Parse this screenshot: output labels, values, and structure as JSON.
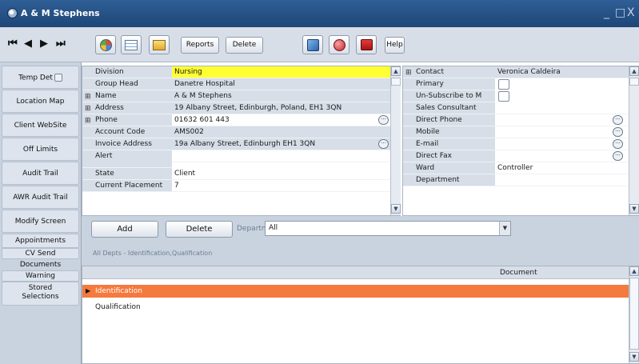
{
  "window": {
    "title": "A & M Stephens",
    "controls": [
      "_",
      "□",
      "X"
    ]
  },
  "toolbar": {
    "nav": [
      "⏮",
      "◀",
      "▶",
      "⏭"
    ],
    "icons": [
      "refresh-icon",
      "grid-view-icon",
      "note-icon",
      "phone-icon",
      "globe-icon",
      "delete-record-icon"
    ],
    "reports_label": "Reports",
    "delete_label": "Delete",
    "help_label": "Help"
  },
  "left_nav": {
    "items": [
      {
        "label": "Temp Det"
      },
      {
        "label": "Location Map"
      },
      {
        "label": "Client WebSite"
      },
      {
        "label": "Off Limits"
      },
      {
        "label": "Audit Trail"
      },
      {
        "label": "AWR Audit Trail"
      },
      {
        "label": "Modify Screen"
      },
      {
        "label": "Appointments"
      },
      {
        "label": "CV Send"
      },
      {
        "label": "Documents"
      },
      {
        "label": "Warning"
      },
      {
        "label": "Stored Selections"
      }
    ]
  },
  "details": {
    "rows": [
      {
        "label": "Division",
        "value": "Nursing",
        "style": "yellow"
      },
      {
        "label": "Group Head",
        "value": "Danetre Hospital",
        "style": "grey"
      },
      {
        "label": "Name",
        "value": "A & M Stephens",
        "style": "grey",
        "expander": "⊞"
      },
      {
        "label": "Address",
        "value": "19 Albany Street, Edinburgh, Poland, EH1 3QN",
        "style": "grey",
        "expander": "⊞"
      },
      {
        "label": "Phone",
        "value": "01632 601 443",
        "style": "white",
        "expander": "⊞",
        "ellipsis": true
      },
      {
        "label": "Account Code",
        "value": "AMS002",
        "style": "grey"
      },
      {
        "label": "Invoice Address",
        "value": "19a Albany Street, Edinburgh EH1 3QN",
        "style": "grey",
        "ellipsis": true
      },
      {
        "label": "Alert",
        "value": "",
        "style": "white"
      },
      {
        "label": "State",
        "value": "Client",
        "style": "white"
      },
      {
        "label": "Current Placement",
        "value": "7",
        "style": "white"
      }
    ]
  },
  "contacts": {
    "rows": [
      {
        "label": "Contact",
        "value": "Veronica Caldeira",
        "expander": "⊞",
        "style": "grey"
      },
      {
        "label": "Primary",
        "value": "",
        "checkbox": true
      },
      {
        "label": "Un-Subscribe to M",
        "value": "",
        "checkbox": true
      },
      {
        "label": "Sales Consultant",
        "value": ""
      },
      {
        "label": "Direct Phone",
        "value": "",
        "ellipsis": true
      },
      {
        "label": "Mobile",
        "value": "",
        "ellipsis": true
      },
      {
        "label": "E-mail",
        "value": "",
        "ellipsis": true
      },
      {
        "label": "Direct Fax",
        "value": "",
        "ellipsis": true
      },
      {
        "label": "Ward",
        "value": "Controller"
      },
      {
        "label": "Department",
        "value": ""
      }
    ]
  },
  "actions": {
    "add_label": "Add",
    "delete_label": "Delete",
    "department_label": "Department",
    "department_value": "All",
    "filter_text": "All Depts - Identification,Qualification"
  },
  "documents": {
    "column_header": "Document",
    "rows": [
      {
        "label": "Identification",
        "selected": true
      },
      {
        "label": "Qualification",
        "selected": false
      }
    ]
  },
  "colors": {
    "title_bar": "#1d4677",
    "highlight_yellow": "#ffff33",
    "selected_row": "#f47a3e",
    "panel_bg": "#c9d3df"
  }
}
